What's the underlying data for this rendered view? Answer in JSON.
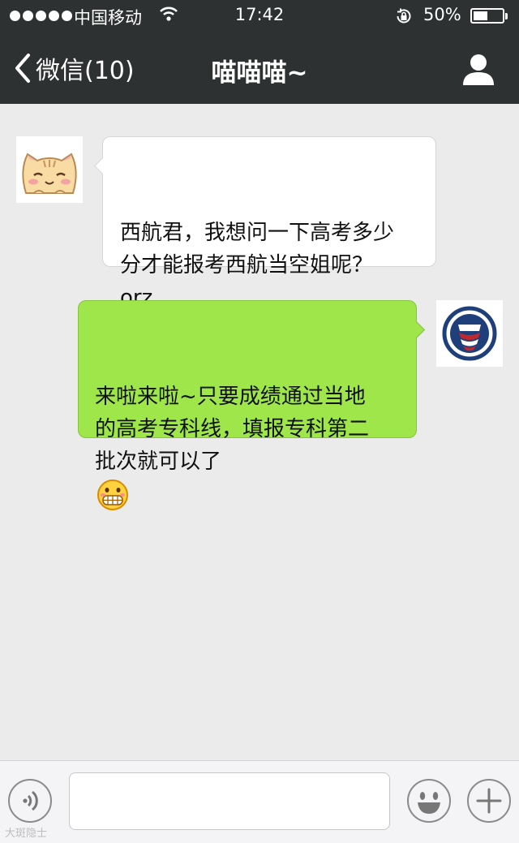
{
  "status_bar": {
    "carrier": "中国移动",
    "time": "17:42",
    "battery_pct": "50%",
    "battery_level": 0.5
  },
  "nav": {
    "back_label": "微信(10)",
    "title": "喵喵喵~"
  },
  "messages": [
    {
      "direction": "in",
      "text": "西航君，我想问一下高考多少\n分才能报考西航当空姐呢？\norz"
    },
    {
      "direction": "out",
      "text": "来啦来啦~只要成绩通过当地\n的高考专科线，填报专科第二\n批次就可以了",
      "emoji": "grinning-face-emoji"
    }
  ],
  "input_bar": {
    "placeholder": ""
  },
  "colors": {
    "nav_bg": "#2e3132",
    "chat_bg": "#ebebeb",
    "outgoing_bubble": "#9ee64a",
    "incoming_bubble": "#ffffff"
  },
  "watermark": "大斑隐士"
}
